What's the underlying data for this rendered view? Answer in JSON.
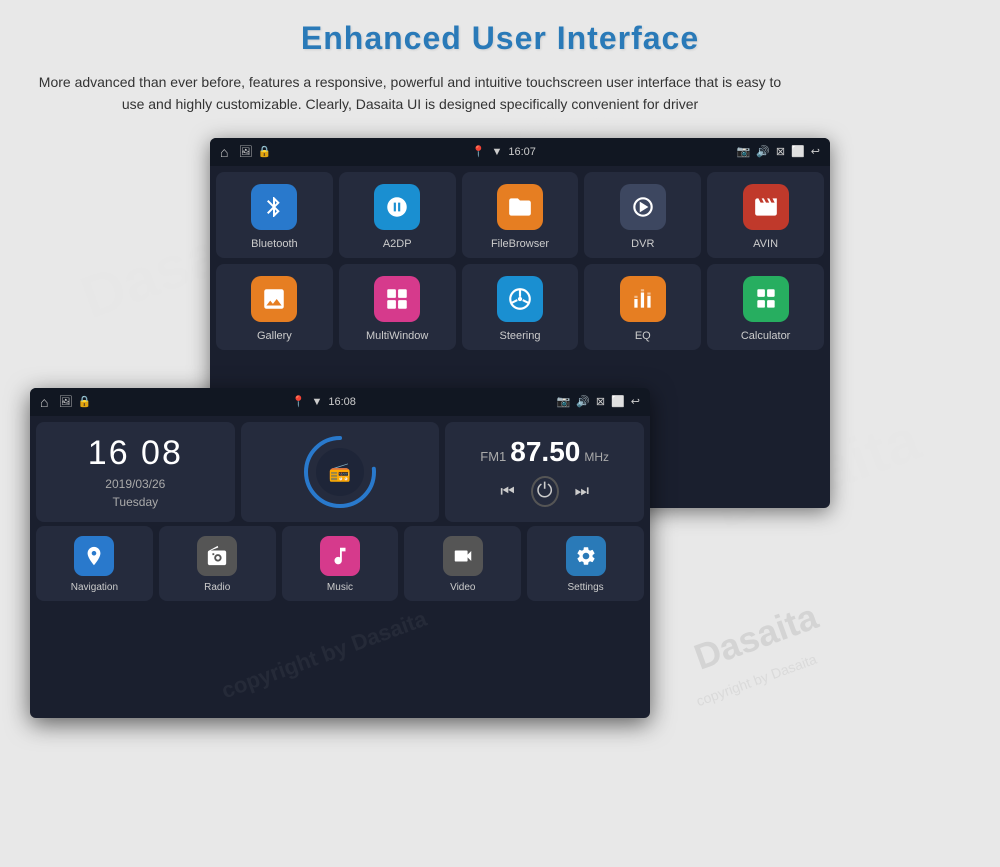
{
  "header": {
    "title": "Enhanced User Interface",
    "description": "More advanced than ever before, features a responsive, powerful and intuitive touchscreen user interface that is easy to use and highly customizable. Clearly, Dasaita UI is designed specifically convenient for driver"
  },
  "back_screen": {
    "status_bar": {
      "time": "16:07",
      "left_icons": [
        "⌂",
        "🖼",
        "🔒"
      ],
      "right_icons": [
        "📷",
        "🔊",
        "⊡",
        "⬜",
        "↩"
      ]
    },
    "apps": [
      {
        "id": "bluetooth",
        "label": "Bluetooth",
        "icon": "✱",
        "color": "icon-bluetooth"
      },
      {
        "id": "a2dp",
        "label": "A2DP",
        "icon": "🎧",
        "color": "icon-a2dp"
      },
      {
        "id": "filebrowser",
        "label": "FileBrowser",
        "icon": "📁",
        "color": "icon-filebrowser"
      },
      {
        "id": "dvr",
        "label": "DVR",
        "icon": "⏱",
        "color": "icon-dvr"
      },
      {
        "id": "avin",
        "label": "AVIN",
        "icon": "▶",
        "color": "icon-avin"
      },
      {
        "id": "gallery",
        "label": "Gallery",
        "icon": "🖼",
        "color": "icon-gallery"
      },
      {
        "id": "multiwindow",
        "label": "MultiWindow",
        "icon": "⊞",
        "color": "icon-multiwindow"
      },
      {
        "id": "steering",
        "label": "Steering",
        "icon": "⊙",
        "color": "icon-steering"
      },
      {
        "id": "eq",
        "label": "EQ",
        "icon": "≡",
        "color": "icon-eq"
      },
      {
        "id": "calculator",
        "label": "Calculator",
        "icon": "⊞",
        "color": "icon-calculator"
      }
    ]
  },
  "front_screen": {
    "status_bar": {
      "time": "16:08",
      "left_icons": [
        "⌂",
        "🖼",
        "🔒"
      ],
      "right_icons": [
        "📷",
        "🔊",
        "⊡",
        "⬜",
        "↩"
      ]
    },
    "clock": {
      "time": "16 08",
      "date": "2019/03/26",
      "day": "Tuesday"
    },
    "radio": {
      "band": "FM1",
      "frequency": "87.50",
      "unit": "MHz"
    },
    "bottom_apps": [
      {
        "id": "navigation",
        "label": "Navigation",
        "icon": "📍",
        "color": "icon-navigation"
      },
      {
        "id": "radio",
        "label": "Radio",
        "icon": "📻",
        "color": "icon-radio"
      },
      {
        "id": "music",
        "label": "Music",
        "icon": "♪",
        "color": "icon-music"
      },
      {
        "id": "video",
        "label": "Video",
        "icon": "🎬",
        "color": "icon-video"
      },
      {
        "id": "settings",
        "label": "Settings",
        "icon": "⚙",
        "color": "icon-settings"
      }
    ]
  },
  "watermark": "Dasaita"
}
